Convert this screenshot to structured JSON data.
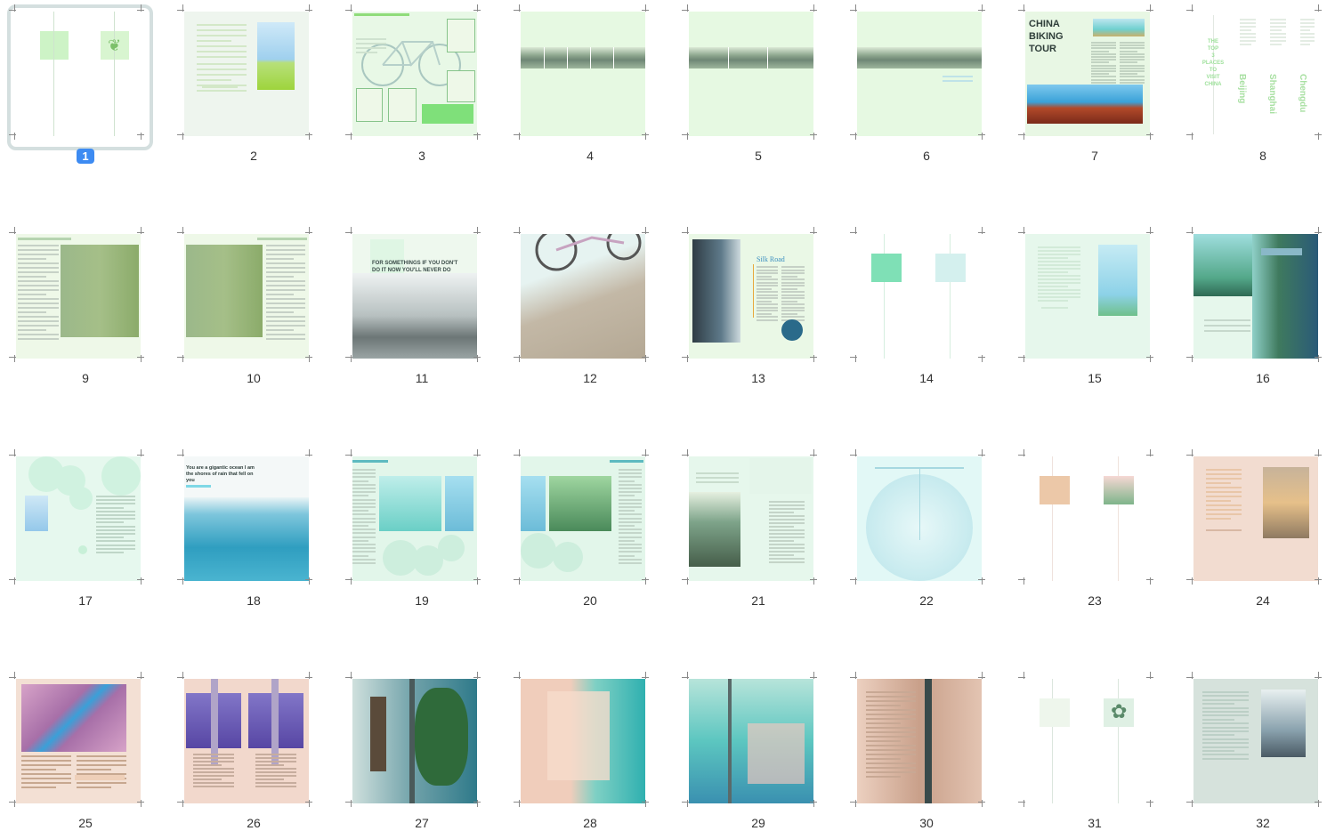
{
  "selected_page": 1,
  "pages": [
    {
      "num": "1",
      "bg": "#ffffff",
      "title": ""
    },
    {
      "num": "2",
      "bg": "#eef5ee",
      "title": ""
    },
    {
      "num": "3",
      "bg": "#e8f8e6",
      "title": ""
    },
    {
      "num": "4",
      "bg": "#e6f9e2",
      "title": ""
    },
    {
      "num": "5",
      "bg": "#e6f9e2",
      "title": ""
    },
    {
      "num": "6",
      "bg": "#e6f9e2",
      "title": ""
    },
    {
      "num": "7",
      "bg": "#e8f7e4",
      "title": "CHINA BIKING TOUR"
    },
    {
      "num": "8",
      "bg": "#ffffff",
      "title": ""
    },
    {
      "num": "9",
      "bg": "#eef8e8",
      "title": ""
    },
    {
      "num": "10",
      "bg": "#eef8e8",
      "title": ""
    },
    {
      "num": "11",
      "bg": "#eef8ee",
      "title": "FOR SOMETHINGS IF YOU DON'T DO IT NOW YOU'LL NEVER DO"
    },
    {
      "num": "12",
      "bg": "#d8e2e0",
      "title": ""
    },
    {
      "num": "13",
      "bg": "#eaf8e6",
      "title": "Silk Road"
    },
    {
      "num": "14",
      "bg": "#ffffff",
      "title": ""
    },
    {
      "num": "15",
      "bg": "#e6f7ec",
      "title": ""
    },
    {
      "num": "16",
      "bg": "#e6f7ec",
      "title": ""
    },
    {
      "num": "17",
      "bg": "#e6f8ee",
      "title": ""
    },
    {
      "num": "18",
      "bg": "#f4f8f8",
      "title": "You are a gigantic ocean I am the shores of rain that fell on you"
    },
    {
      "num": "19",
      "bg": "#e2f6ea",
      "title": ""
    },
    {
      "num": "20",
      "bg": "#e2f6ea",
      "title": ""
    },
    {
      "num": "21",
      "bg": "#e6f7ec",
      "title": ""
    },
    {
      "num": "22",
      "bg": "#e2f8f6",
      "title": ""
    },
    {
      "num": "23",
      "bg": "#ffffff",
      "title": ""
    },
    {
      "num": "24",
      "bg": "#f2dcd0",
      "title": ""
    },
    {
      "num": "25",
      "bg": "#f3e0d4",
      "title": ""
    },
    {
      "num": "26",
      "bg": "#f2d8cc",
      "title": ""
    },
    {
      "num": "27",
      "bg": "#cfe2de",
      "title": ""
    },
    {
      "num": "28",
      "bg": "#f0d6c8",
      "title": ""
    },
    {
      "num": "29",
      "bg": "#8ad6d0",
      "title": ""
    },
    {
      "num": "30",
      "bg": "#ecd2c4",
      "title": ""
    },
    {
      "num": "31",
      "bg": "#ffffff",
      "title": ""
    },
    {
      "num": "32",
      "bg": "#d6e2dc",
      "title": ""
    }
  ],
  "page8_words": [
    "THE",
    "TOP",
    "3",
    "PLACES",
    "TO",
    "VISIT",
    "CHINA"
  ],
  "page8_cities": [
    "Beijing",
    "Shanghai",
    "Chengdu"
  ],
  "colors": {
    "accent": "#3d8bf2",
    "ring": "#d4dfdf",
    "mint": "#c8f0d8",
    "teal": "#5cc8c0",
    "green": "#9bd88a",
    "peach": "#e8bca0"
  }
}
